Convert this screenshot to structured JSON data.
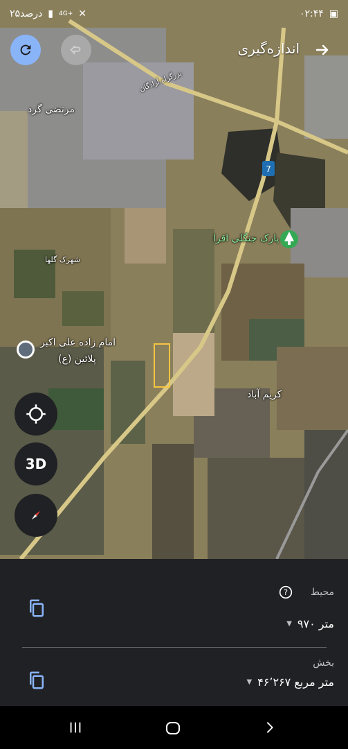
{
  "status_bar": {
    "time": "۰۲:۴۴",
    "battery": "۲۵درصد",
    "signal": "4G+"
  },
  "header": {
    "title": "اندازه‌گیری",
    "icons": [
      "reload-icon",
      "undo-icon",
      "back-arrow-icon"
    ]
  },
  "map": {
    "labels": {
      "place_1": "مرتضی گرد",
      "place_2": "شهرک گلها",
      "park": "پارک جنگلی اقرا",
      "shrine": "امام زاده علی اکبر",
      "shrine_2": "(ع) پلائین",
      "village": "کریم آباد",
      "highway_sign": "7",
      "road_label": "بزرگراه آزادگان"
    },
    "controls": {
      "btn_3d": "3D"
    },
    "accent_colors": {
      "measure_area": "#f5c542",
      "park_icon": "#34a853",
      "highway": "#e8d28a"
    }
  },
  "panel": {
    "perimeter_label": "محیط",
    "perimeter_value": "۹۷۰ متر",
    "area_label": "بخش",
    "area_value": "۴۶٬۲۶۷ متر مربع"
  }
}
